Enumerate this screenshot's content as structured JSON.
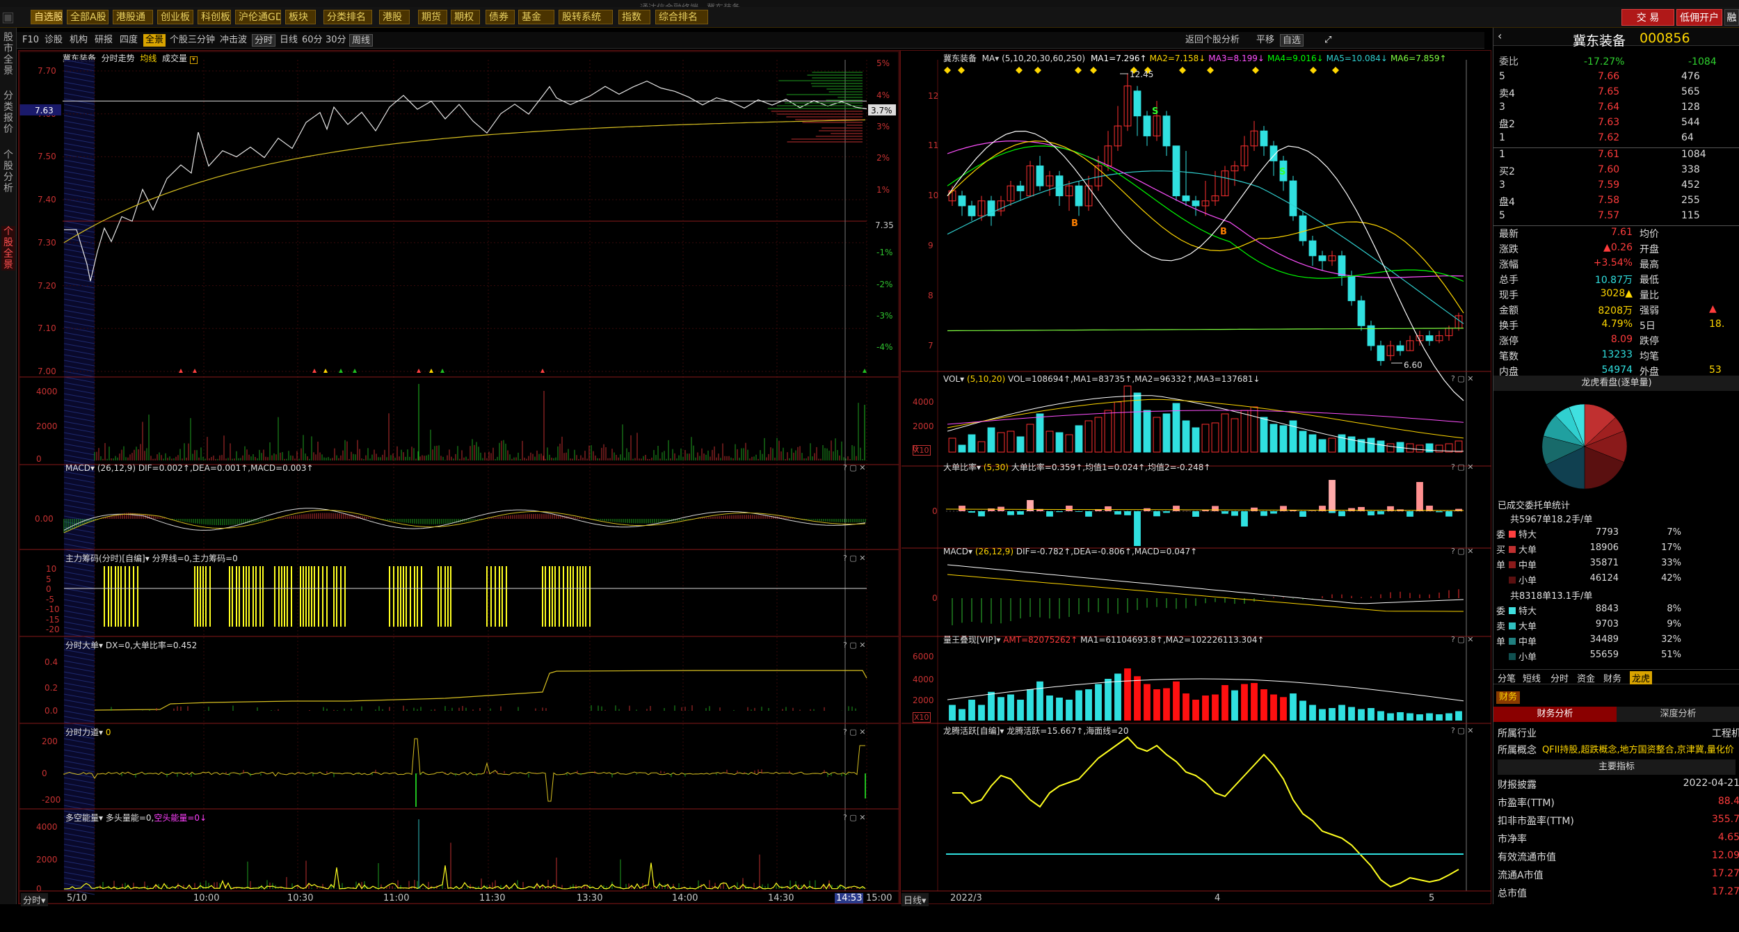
{
  "app": {
    "title_bar": "通达信金融终端 - 冀东装备",
    "trade_btn": "交 易",
    "open_btn": "低佣开户",
    "extra_btn": "融资"
  },
  "menu": [
    "自选股",
    "全部A股",
    "港股通",
    "创业板",
    "科创板",
    "沪伦通GDR",
    "板块",
    "分类排名",
    "港股",
    "期货",
    "期权",
    "债券",
    "基金",
    "股转系统",
    "指数",
    "综合排名"
  ],
  "leftnav": [
    "股市全景",
    "分类报价",
    "个股分析",
    "个股全景"
  ],
  "toolbar2": {
    "items": [
      "F10",
      "诊股",
      "机构",
      "研报",
      "四度",
      "全景",
      "个股三分钟",
      "冲击波"
    ],
    "periods": [
      "分时",
      "日线",
      "60分",
      "30分",
      "周线"
    ],
    "right": [
      "返回个股分析",
      "平移",
      "自选"
    ]
  },
  "intraday": {
    "title": "冀东装备",
    "chart_label": "分时走势",
    "avg_label": "均线",
    "vol_label": "成交量",
    "price_ticks": [
      "7.70",
      "7.60",
      "7.50",
      "7.40",
      "7.30",
      "7.20",
      "7.10",
      "7.00"
    ],
    "pct_ticks": [
      "5%",
      "4%",
      "3%",
      "2%",
      "1%",
      "-1%",
      "-2%",
      "-3%",
      "-4%"
    ],
    "current_price": "7.63",
    "current_pct": "3.7%",
    "ref_price": "7.35",
    "vol_ticks": [
      "4000",
      "2000",
      "0"
    ],
    "time_labels": [
      "5/10",
      "10:00",
      "10:30",
      "11:00",
      "11:30",
      "13:30",
      "14:00",
      "14:30",
      "14:53",
      "15:00"
    ],
    "bottom_tab": "分时"
  },
  "sub_intraday": [
    {
      "name": "MACD",
      "params": "(26,12,9)",
      "values": "DIF=0.002↑,DEA=0.001↑,MACD=0.003↑",
      "ticks": [
        "0.00"
      ]
    },
    {
      "name": "主力筹码(分时)[自编]",
      "params": "",
      "values": "分界线=0,主力筹码=0",
      "ticks": [
        "10",
        "5",
        "0",
        "-5",
        "-10",
        "-15",
        "-20"
      ]
    },
    {
      "name": "分时大单",
      "params": "",
      "values": "DX=0,大单比率=0.452",
      "ticks": [
        "0.4",
        "0.2",
        "0.0"
      ]
    },
    {
      "name": "分时力道",
      "params": "",
      "values": "0",
      "ticks": [
        "200",
        "0",
        "-200"
      ]
    },
    {
      "name": "多空能量",
      "params": "",
      "values": "多头量能=0,",
      "values2": "空头能量=0↓",
      "ticks": [
        "4000",
        "2000",
        "0"
      ]
    }
  ],
  "daily": {
    "title": "冀东装备",
    "ma_label": "MA",
    "ma_params": "(5,10,20,30,60,250)",
    "ma_values": [
      "MA1=7.296↑",
      "MA2=7.158↓",
      "MA3=8.199↓",
      "MA4=9.016↓",
      "MA5=10.084↓",
      "MA6=7.859↑"
    ],
    "ma_colors": [
      "#ffffff",
      "#ffd700",
      "#ff50ff",
      "#00ff00",
      "#30d0d0",
      "#80ff40"
    ],
    "price_ticks": [
      "12",
      "11",
      "10",
      "9",
      "8",
      "7"
    ],
    "high_label": "12.45",
    "low_label": "6.60",
    "signals": [
      "S",
      "S",
      "B",
      "B"
    ],
    "x_labels": [
      "2022/3",
      "4",
      "5"
    ],
    "bottom_tab": "日线"
  },
  "sub_daily": [
    {
      "name": "VOL",
      "params": "(5,10,20)",
      "values": "VOL=108694↑,MA1=83735↑,MA2=96332↑,MA3=137681↓",
      "ticks": [
        "4000",
        "2000",
        "0"
      ],
      "unit": "X10"
    },
    {
      "name": "大单比率",
      "params": "(5,30)",
      "values": "大单比率=0.359↑,均值1=0.024↑,均值2=-0.248↑",
      "ticks": [
        "0"
      ]
    },
    {
      "name": "MACD",
      "params": "(26,12,9)",
      "values": "DIF=-0.782↑,DEA=-0.806↑,MACD=0.047↑",
      "ticks": [
        "0"
      ]
    },
    {
      "name": "量王叠现[VIP]",
      "params": "",
      "values_red": "AMT=82075262↑",
      "values": "MA1=61104693.8↑,MA2=102226113.304↑",
      "ticks": [
        "6000",
        "4000",
        "2000"
      ],
      "unit": "X10"
    },
    {
      "name": "龙腾活跃[自编]",
      "params": "",
      "values": "龙腾活跃=15.667↑,海面线=20",
      "ticks": []
    }
  ],
  "right_panel": {
    "stock_name": "冀东装备",
    "stock_code": "000856",
    "weibi_label": "委比",
    "weibi": "-17.27%",
    "weicha": "-1084",
    "sells": [
      {
        "label": "5",
        "price": "7.66",
        "vol": "476"
      },
      {
        "label": "卖4",
        "price": "7.65",
        "vol": "565"
      },
      {
        "label": "3",
        "price": "7.64",
        "vol": "128"
      },
      {
        "label": "盘2",
        "price": "7.63",
        "vol": "544"
      },
      {
        "label": "1",
        "price": "7.62",
        "vol": "64"
      }
    ],
    "buys": [
      {
        "label": "1",
        "price": "7.61",
        "vol": "1084"
      },
      {
        "label": "买2",
        "price": "7.60",
        "vol": "338"
      },
      {
        "label": "3",
        "price": "7.59",
        "vol": "452"
      },
      {
        "label": "盘4",
        "price": "7.58",
        "vol": "255"
      },
      {
        "label": "5",
        "price": "7.57",
        "vol": "115"
      }
    ],
    "stats": [
      {
        "l1": "最新",
        "v1": "7.61",
        "l2": "均价",
        "v2": ""
      },
      {
        "l1": "涨跌",
        "v1": "▲0.26",
        "l2": "开盘",
        "v2": ""
      },
      {
        "l1": "涨幅",
        "v1": "+3.54%",
        "l2": "最高",
        "v2": ""
      },
      {
        "l1": "总手",
        "v1": "10.87万",
        "l2": "最低",
        "v2": ""
      },
      {
        "l1": "现手",
        "v1": "3028▲",
        "l2": "量比",
        "v2": ""
      },
      {
        "l1": "金额",
        "v1": "8208万",
        "l2": "强弱",
        "v2": "▲"
      },
      {
        "l1": "换手",
        "v1": "4.79%",
        "l2": "5日",
        "v2": "18."
      },
      {
        "l1": "涨停",
        "v1": "8.09",
        "l2": "跌停",
        "v2": ""
      },
      {
        "l1": "笔数",
        "v1": "13233",
        "l2": "均笔",
        "v2": ""
      },
      {
        "l1": "内盘",
        "v1": "54974",
        "l2": "外盘",
        "v2": "53"
      }
    ],
    "pie_title": "龙虎看盘(逐单量)",
    "order_stats_title": "已成交委托单统计",
    "buy_total": "共5967单18.2手/单",
    "buy_rows": [
      {
        "side": "委",
        "type": "特大",
        "count": "7793",
        "pct": "7%"
      },
      {
        "side": "买",
        "type": "大单",
        "count": "18906",
        "pct": "17%"
      },
      {
        "side": "单",
        "type": "中单",
        "count": "35871",
        "pct": "33%"
      },
      {
        "side": "",
        "type": "小单",
        "count": "46124",
        "pct": "42%"
      }
    ],
    "sell_total": "共8318单13.1手/单",
    "sell_rows": [
      {
        "side": "委",
        "type": "特大",
        "count": "8843",
        "pct": "8%"
      },
      {
        "side": "卖",
        "type": "大单",
        "count": "9703",
        "pct": "9%"
      },
      {
        "side": "单",
        "type": "中单",
        "count": "34489",
        "pct": "32%"
      },
      {
        "side": "",
        "type": "小单",
        "count": "55659",
        "pct": "51%"
      }
    ],
    "tabs": [
      "分笔",
      "短线",
      "分时",
      "资金",
      "财务",
      "龙虎"
    ],
    "fin_tab": "财务",
    "fin_subtabs": [
      "财务分析",
      "深度分析"
    ],
    "industry_label": "所属行业",
    "industry": "工程机",
    "concept_label": "所属概念",
    "concept": "QFII持股,超跌概念,地方国资整合,京津冀,量化价",
    "main_index": "主要指标",
    "fin_rows": [
      {
        "l": "财报披露",
        "v": "2022-04-21"
      },
      {
        "l": "市盈率(TTM)",
        "v": "88.4"
      },
      {
        "l": "扣非市盈率(TTM)",
        "v": "355.7"
      },
      {
        "l": "市净率",
        "v": "4.65"
      },
      {
        "l": "有效流通市值",
        "v": "12.09"
      },
      {
        "l": "流通A市值",
        "v": "17.27"
      },
      {
        "l": "总市值",
        "v": "17.27"
      }
    ]
  }
}
